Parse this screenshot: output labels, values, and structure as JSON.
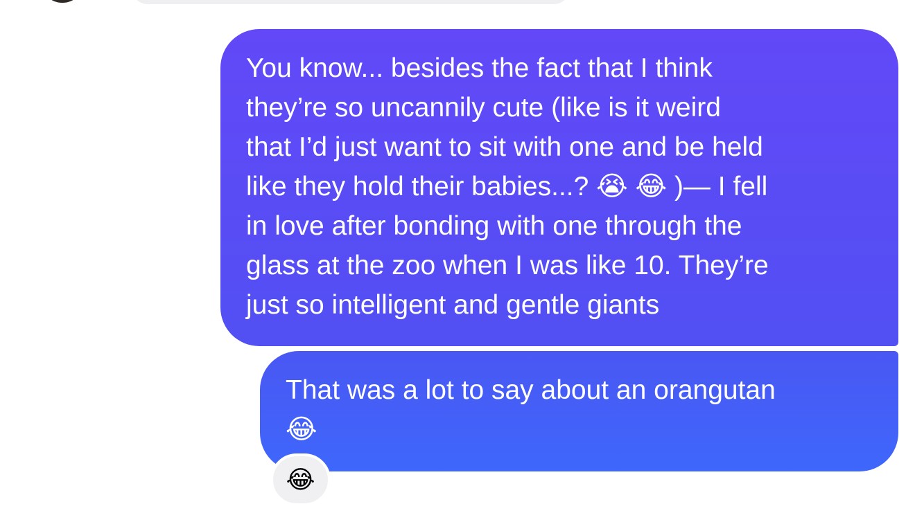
{
  "messages": [
    {
      "sender": "me",
      "text": "You know... besides the fact that I think\nthey’re so uncannily cute (like is it weird\nthat I’d just want to sit with one and be held\nlike they hold their babies...? 😭 😂 )— I fell\nin love after bonding with one through the\nglass at the zoo when I was like 10. They’re\njust so intelligent and gentle giants"
    },
    {
      "sender": "me",
      "text": "That was a lot to say about an orangutan\n😂"
    }
  ],
  "reaction": {
    "emoji": "😂"
  },
  "colors": {
    "bubble_top": "#6248f7",
    "bubble_bottom": "#3e67fb",
    "reaction_bg": "#f0f0f2"
  }
}
